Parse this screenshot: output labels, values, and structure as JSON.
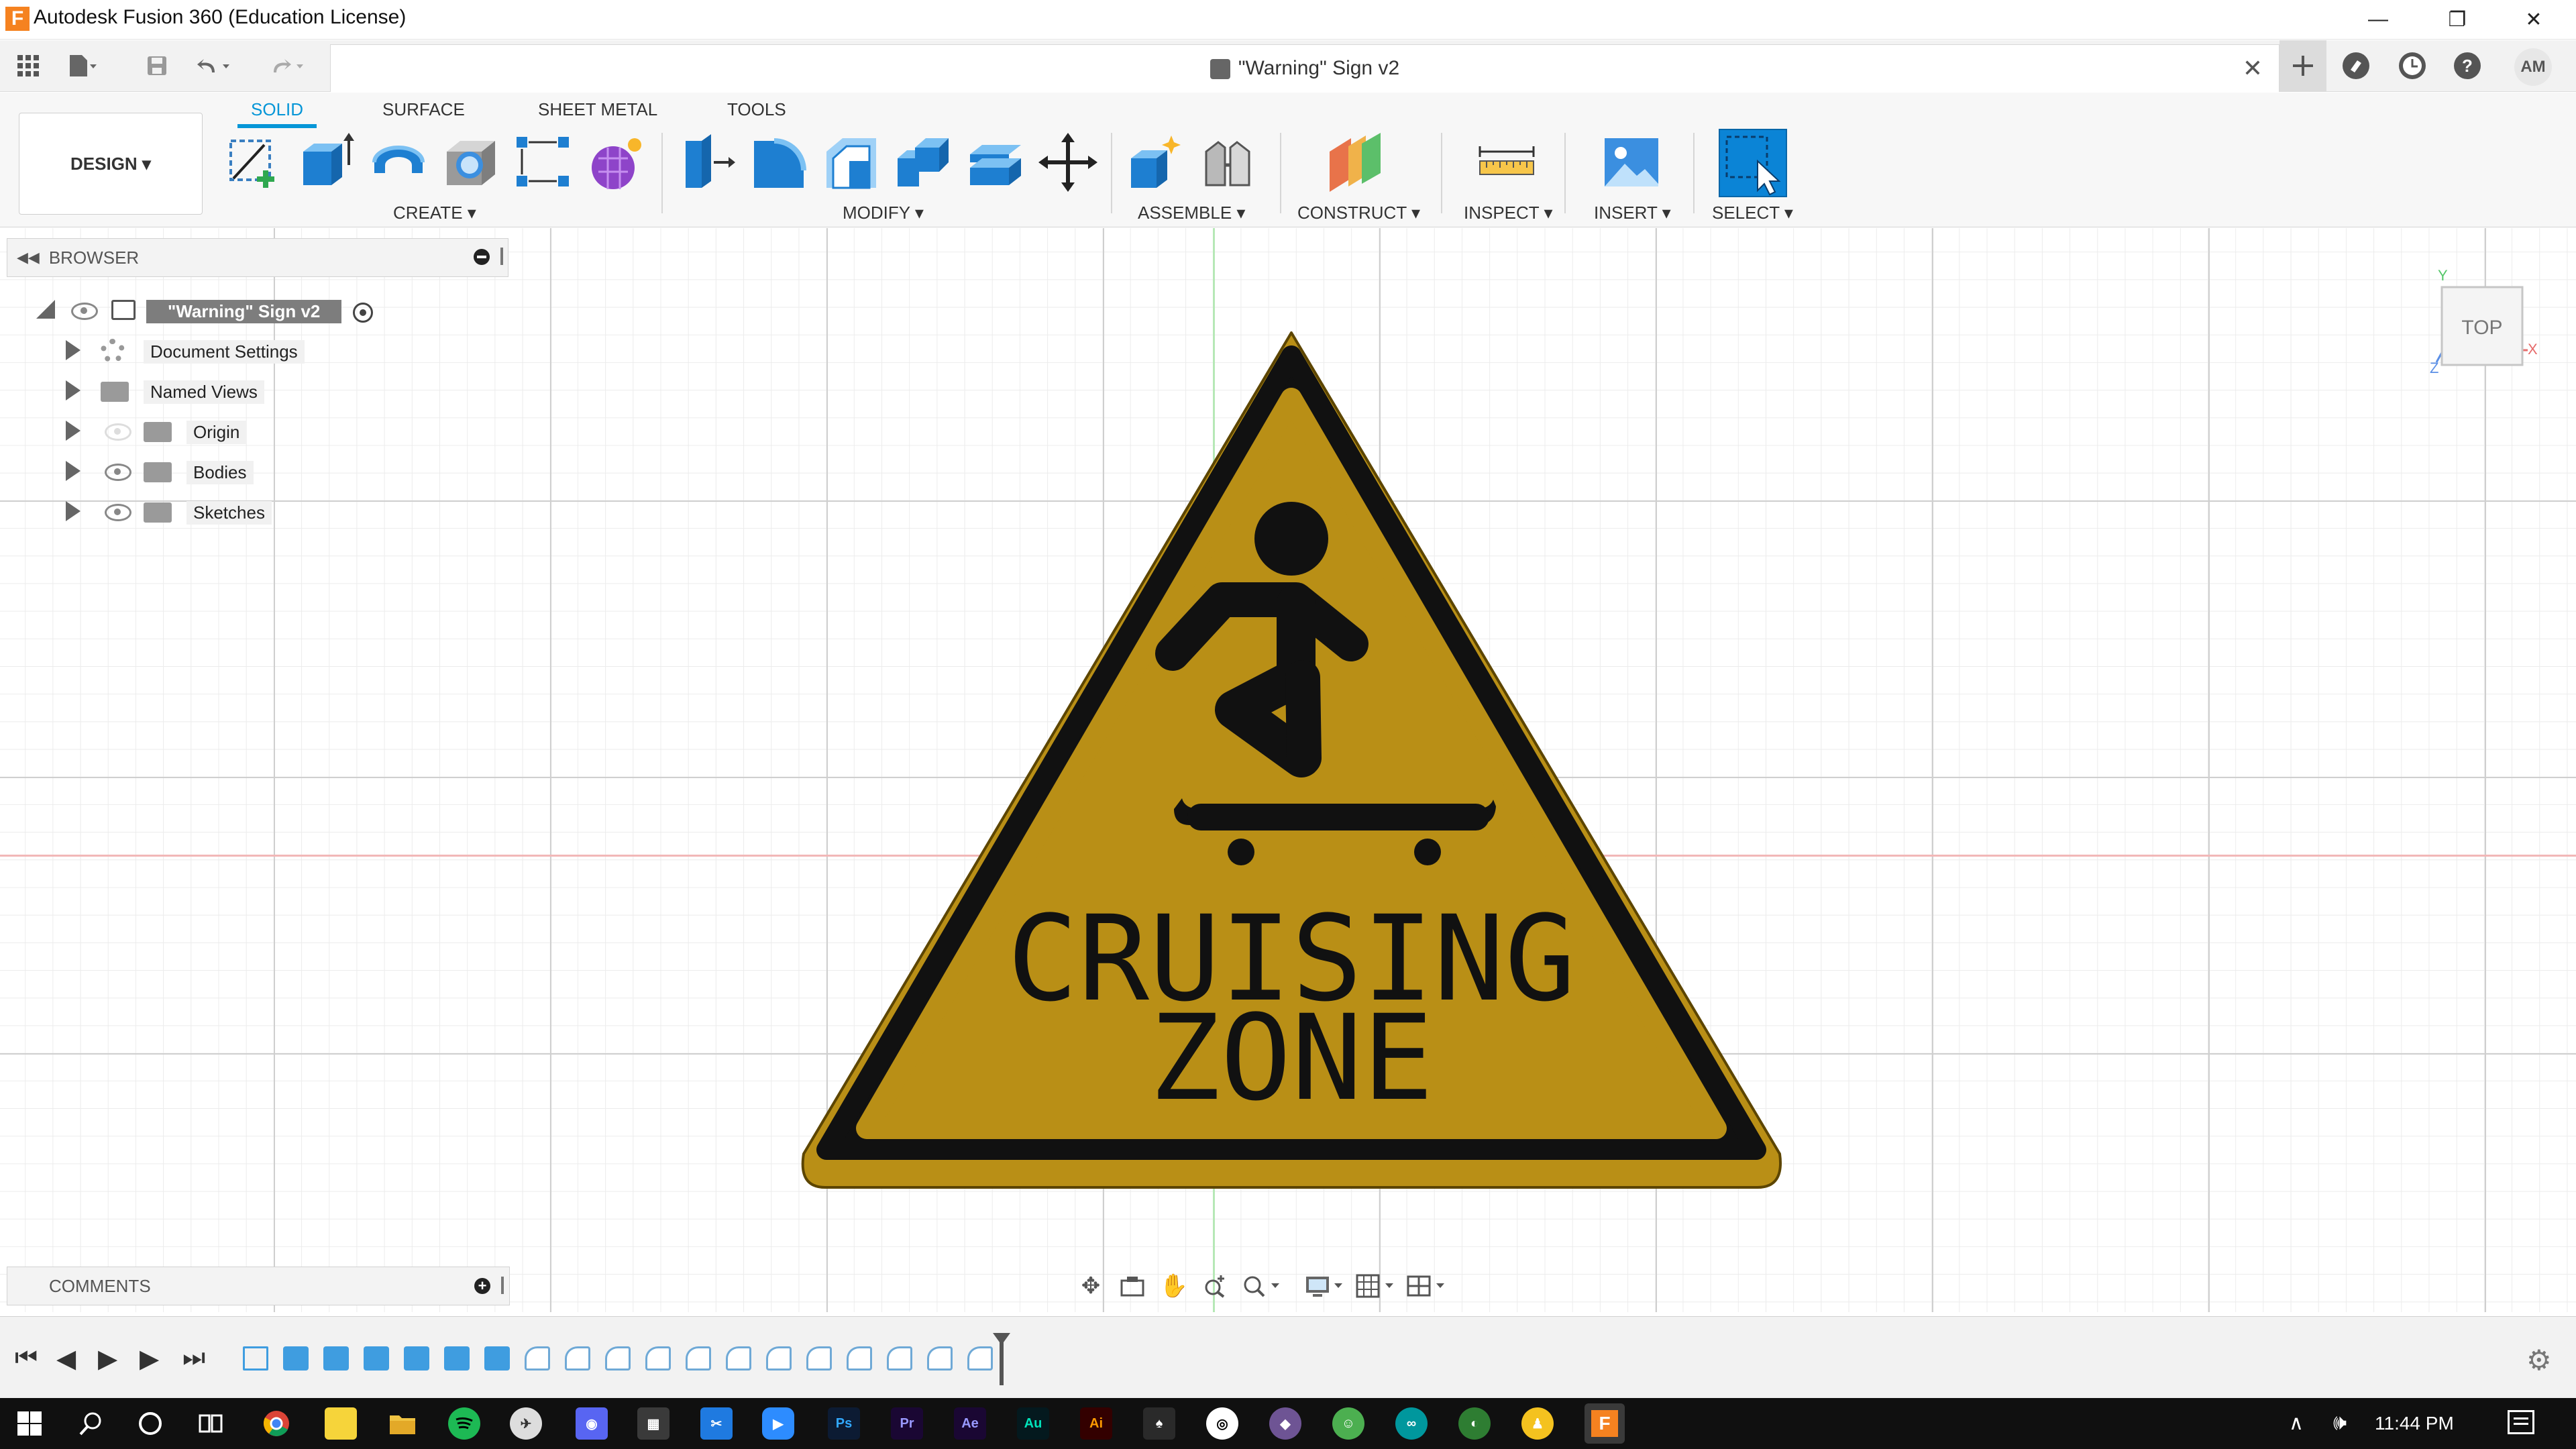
{
  "window": {
    "title": "Autodesk Fusion 360 (Education License)",
    "controls": {
      "minimize": "—",
      "restore": "❐",
      "close": "✕"
    }
  },
  "document": {
    "title": "\"Warning\" Sign v2",
    "close_label": "✕"
  },
  "user": {
    "initials": "AM"
  },
  "workspace": {
    "label": "DESIGN ▾"
  },
  "ribbon": {
    "tabs": [
      {
        "label": "SOLID",
        "active": true
      },
      {
        "label": "SURFACE"
      },
      {
        "label": "SHEET METAL"
      },
      {
        "label": "TOOLS"
      }
    ],
    "groups": {
      "create": "CREATE ▾",
      "modify": "MODIFY ▾",
      "assemble": "ASSEMBLE ▾",
      "construct": "CONSTRUCT ▾",
      "inspect": "INSPECT ▾",
      "insert": "INSERT ▾",
      "select": "SELECT ▾"
    }
  },
  "browser": {
    "header": "BROWSER",
    "root": "\"Warning\" Sign v2",
    "items": [
      {
        "label": "Document Settings",
        "icon": "gear-icon"
      },
      {
        "label": "Named Views",
        "icon": "folder-icon"
      },
      {
        "label": "Origin",
        "icon": "folder-icon",
        "hidden": true
      },
      {
        "label": "Bodies",
        "icon": "folder-icon"
      },
      {
        "label": "Sketches",
        "icon": "folder-icon"
      }
    ]
  },
  "viewcube": {
    "face": "TOP",
    "axis_x": "X",
    "axis_y": "Y",
    "axis_z": "Z"
  },
  "sign": {
    "line1": "CRUISING",
    "line2": "ZONE",
    "colors": {
      "face": "#b8901a",
      "border": "#111111",
      "symbol": "#111111"
    }
  },
  "comments": {
    "header": "COMMENTS"
  },
  "taskbar": {
    "time": "11:44 PM"
  },
  "colors": {
    "accent": "#0696d7",
    "axis_x": "#f2b7b7",
    "axis_y": "#b6e8b6"
  }
}
